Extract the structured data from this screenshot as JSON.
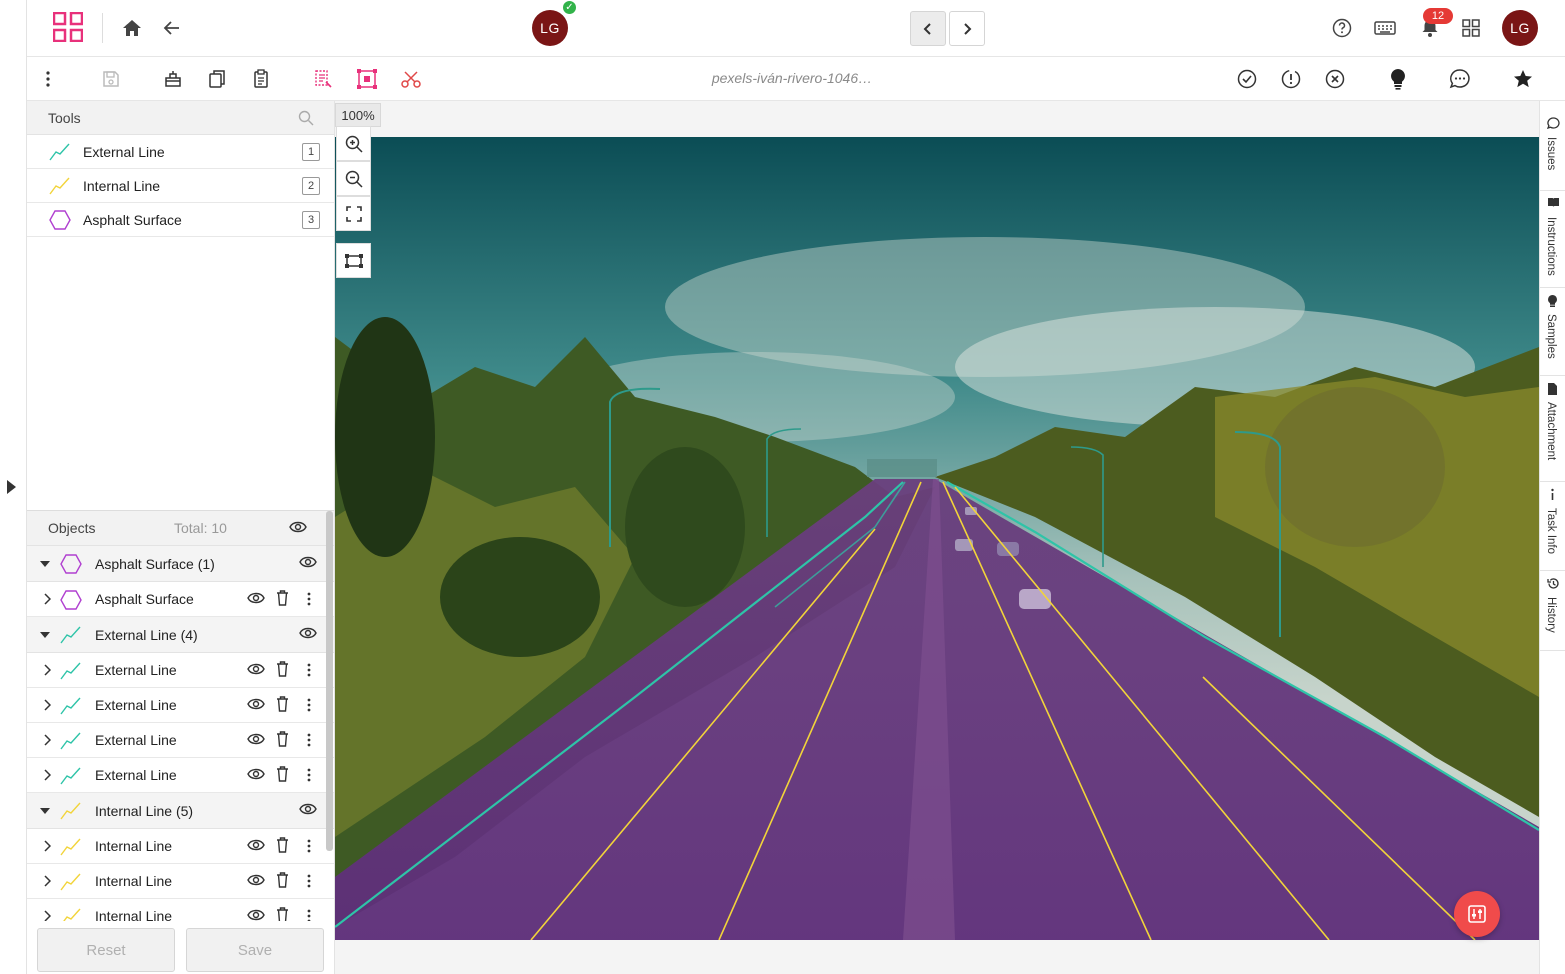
{
  "header": {
    "user_initials": "LG",
    "notification_count": "12",
    "logo_icon": "app-logo-icon",
    "accent": "#e8317b"
  },
  "toolbar": {
    "filename": "pexels-iván-rivero-1046…"
  },
  "tools": {
    "title": "Tools",
    "items": [
      {
        "label": "External Line",
        "hotkey": "1",
        "color": "#2ec4a8"
      },
      {
        "label": "Internal Line",
        "hotkey": "2",
        "color": "#f2d43a"
      },
      {
        "label": "Asphalt Surface",
        "hotkey": "3",
        "color": "#b03fd0"
      }
    ]
  },
  "objects": {
    "title": "Objects",
    "total": "Total: 10",
    "groups": [
      {
        "label": "Asphalt Surface (1)",
        "items": [
          "Asphalt Surface"
        ]
      },
      {
        "label": "External Line (4)",
        "items": [
          "External Line",
          "External Line",
          "External Line",
          "External Line"
        ]
      },
      {
        "label": "Internal Line (5)",
        "items": [
          "Internal Line",
          "Internal Line",
          "Internal Line"
        ]
      }
    ]
  },
  "footer": {
    "reset_label": "Reset",
    "save_label": "Save"
  },
  "canvas": {
    "zoom": "100%"
  },
  "side_tabs": [
    "Issues",
    "Instructions",
    "Samples",
    "Attachment",
    "Task Info",
    "History"
  ]
}
